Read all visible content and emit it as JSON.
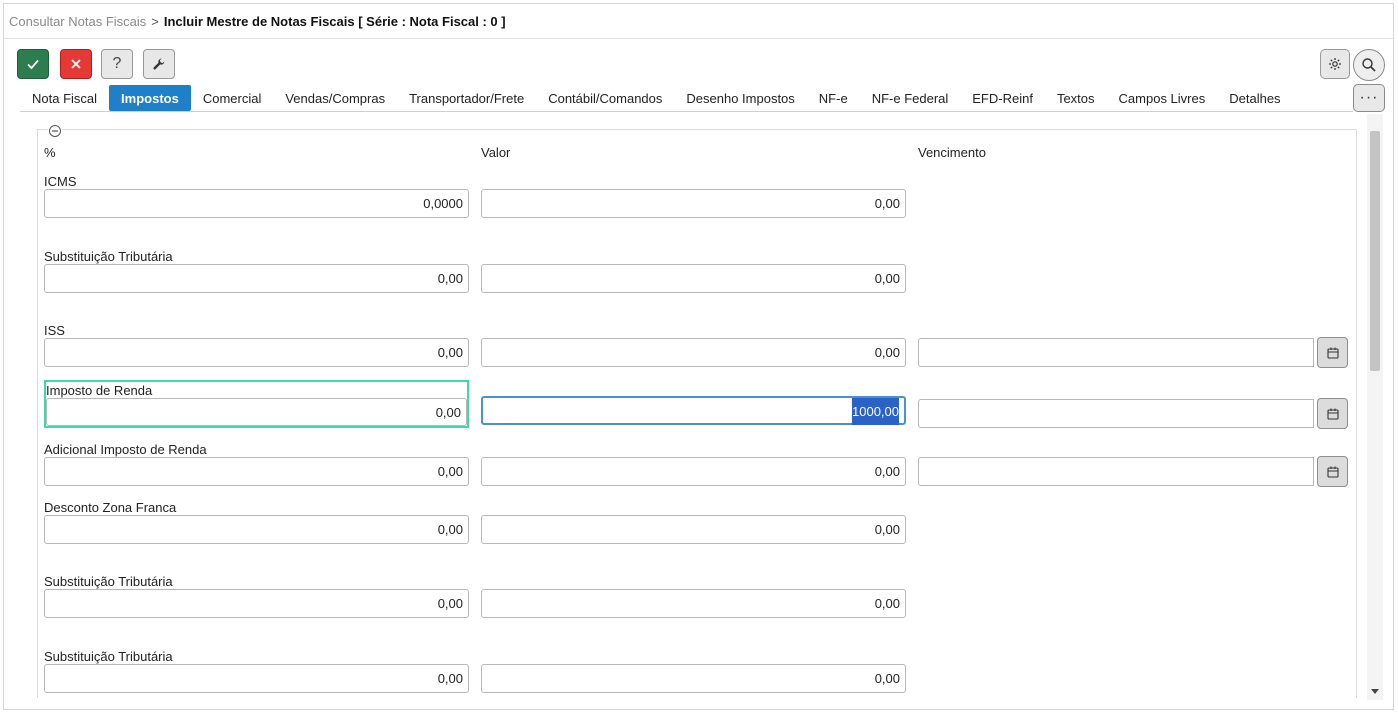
{
  "breadcrumb": {
    "parent": "Consultar Notas Fiscais",
    "separator": ">",
    "current": "Incluir Mestre de Notas Fiscais [ Série : Nota Fiscal : 0 ]"
  },
  "toolbar": {
    "help_label": "?",
    "more_label": "···",
    "colors": {
      "confirm": "#2e7d4f",
      "cancel": "#e53935",
      "tab_active": "#1f7fc8",
      "focus_highlight": "#3fd9a8"
    }
  },
  "tabs": [
    {
      "label": "Nota Fiscal",
      "active": false
    },
    {
      "label": "Impostos",
      "active": true
    },
    {
      "label": "Comercial",
      "active": false
    },
    {
      "label": "Vendas/Compras",
      "active": false
    },
    {
      "label": "Transportador/Frete",
      "active": false
    },
    {
      "label": "Contábil/Comandos",
      "active": false
    },
    {
      "label": "Desenho Impostos",
      "active": false
    },
    {
      "label": "NF-e",
      "active": false
    },
    {
      "label": "NF-e Federal",
      "active": false
    },
    {
      "label": "EFD-Reinf",
      "active": false
    },
    {
      "label": "Textos",
      "active": false
    },
    {
      "label": "Campos Livres",
      "active": false
    },
    {
      "label": "Detalhes",
      "active": false
    }
  ],
  "columns": {
    "percent": "%",
    "value": "Valor",
    "due": "Vencimento"
  },
  "rows": [
    {
      "label": "ICMS",
      "percent": "0,0000",
      "value": "0,00"
    },
    {
      "label": "Substituição Tributária",
      "percent": "0,00",
      "value": "0,00"
    },
    {
      "label": "ISS",
      "percent": "0,00",
      "value": "0,00",
      "due": ""
    },
    {
      "label": "Imposto de Renda",
      "percent": "0,00",
      "value": "1000,00",
      "due": ""
    },
    {
      "label": "Adicional Imposto de Renda",
      "percent": "0,00",
      "value": "0,00",
      "due": ""
    },
    {
      "label": "Desconto Zona Franca",
      "percent": "0,00",
      "value": "0,00"
    },
    {
      "label": "Substituição Tributária",
      "percent": "0,00",
      "value": "0,00"
    },
    {
      "label": "Substituição Tributária",
      "percent": "0,00",
      "value": "0,00"
    }
  ]
}
